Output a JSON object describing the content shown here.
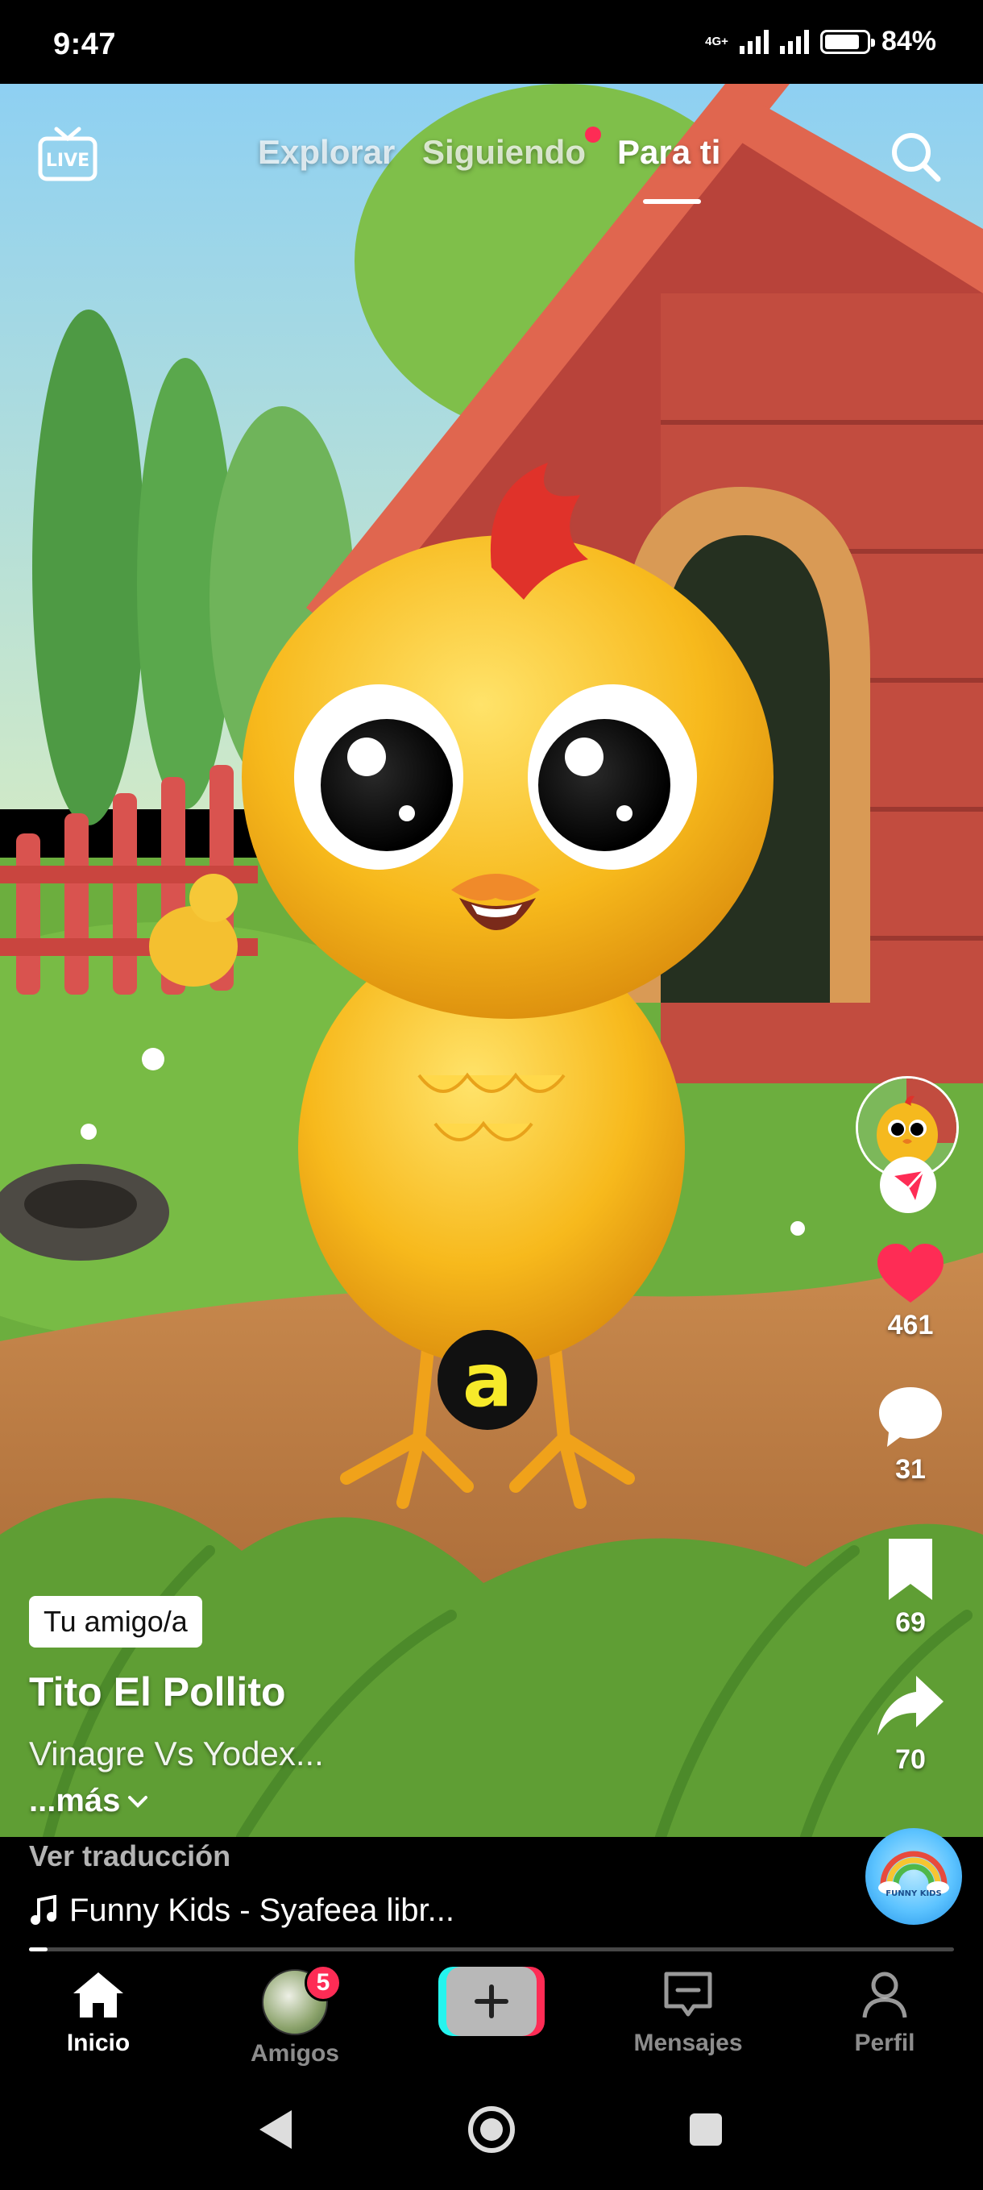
{
  "status_bar": {
    "time": "9:47",
    "network": "4G+",
    "battery_percent": "84%",
    "battery_level": 0.84
  },
  "top_nav": {
    "live_icon": "live-tv-icon",
    "live_label": "LIVE",
    "tabs": [
      {
        "label": "Explorar",
        "active": false
      },
      {
        "label": "Siguiendo",
        "active": false,
        "has_dot": true
      },
      {
        "label": "Para ti",
        "active": true
      }
    ],
    "search_icon": "search-icon"
  },
  "video": {
    "overlay_letter": "a"
  },
  "actions": {
    "likes": "461",
    "comments": "31",
    "saves": "69",
    "shares": "70",
    "like_color": "#fe2c55"
  },
  "caption": {
    "friend_tag": "Tu amigo/a",
    "author": "Tito El Pollito",
    "description": "Vinagre Vs Yodex...",
    "more": "...más",
    "translate": "Ver traducción",
    "music": "Funny Kids - Syafeea libr...",
    "music_disc_label": "FUNNY KIDS",
    "progress": 0.02
  },
  "bottom_nav": {
    "items": [
      {
        "label": "Inicio",
        "icon": "home-icon",
        "active": true
      },
      {
        "label": "Amigos",
        "icon": "friends-avatar",
        "badge": "5"
      },
      {
        "label": "",
        "icon": "create-plus-icon"
      },
      {
        "label": "Mensajes",
        "icon": "inbox-icon"
      },
      {
        "label": "Perfil",
        "icon": "profile-icon"
      }
    ]
  },
  "colors": {
    "accent": "#fe2c55",
    "accent_cyan": "#25f4ee"
  }
}
